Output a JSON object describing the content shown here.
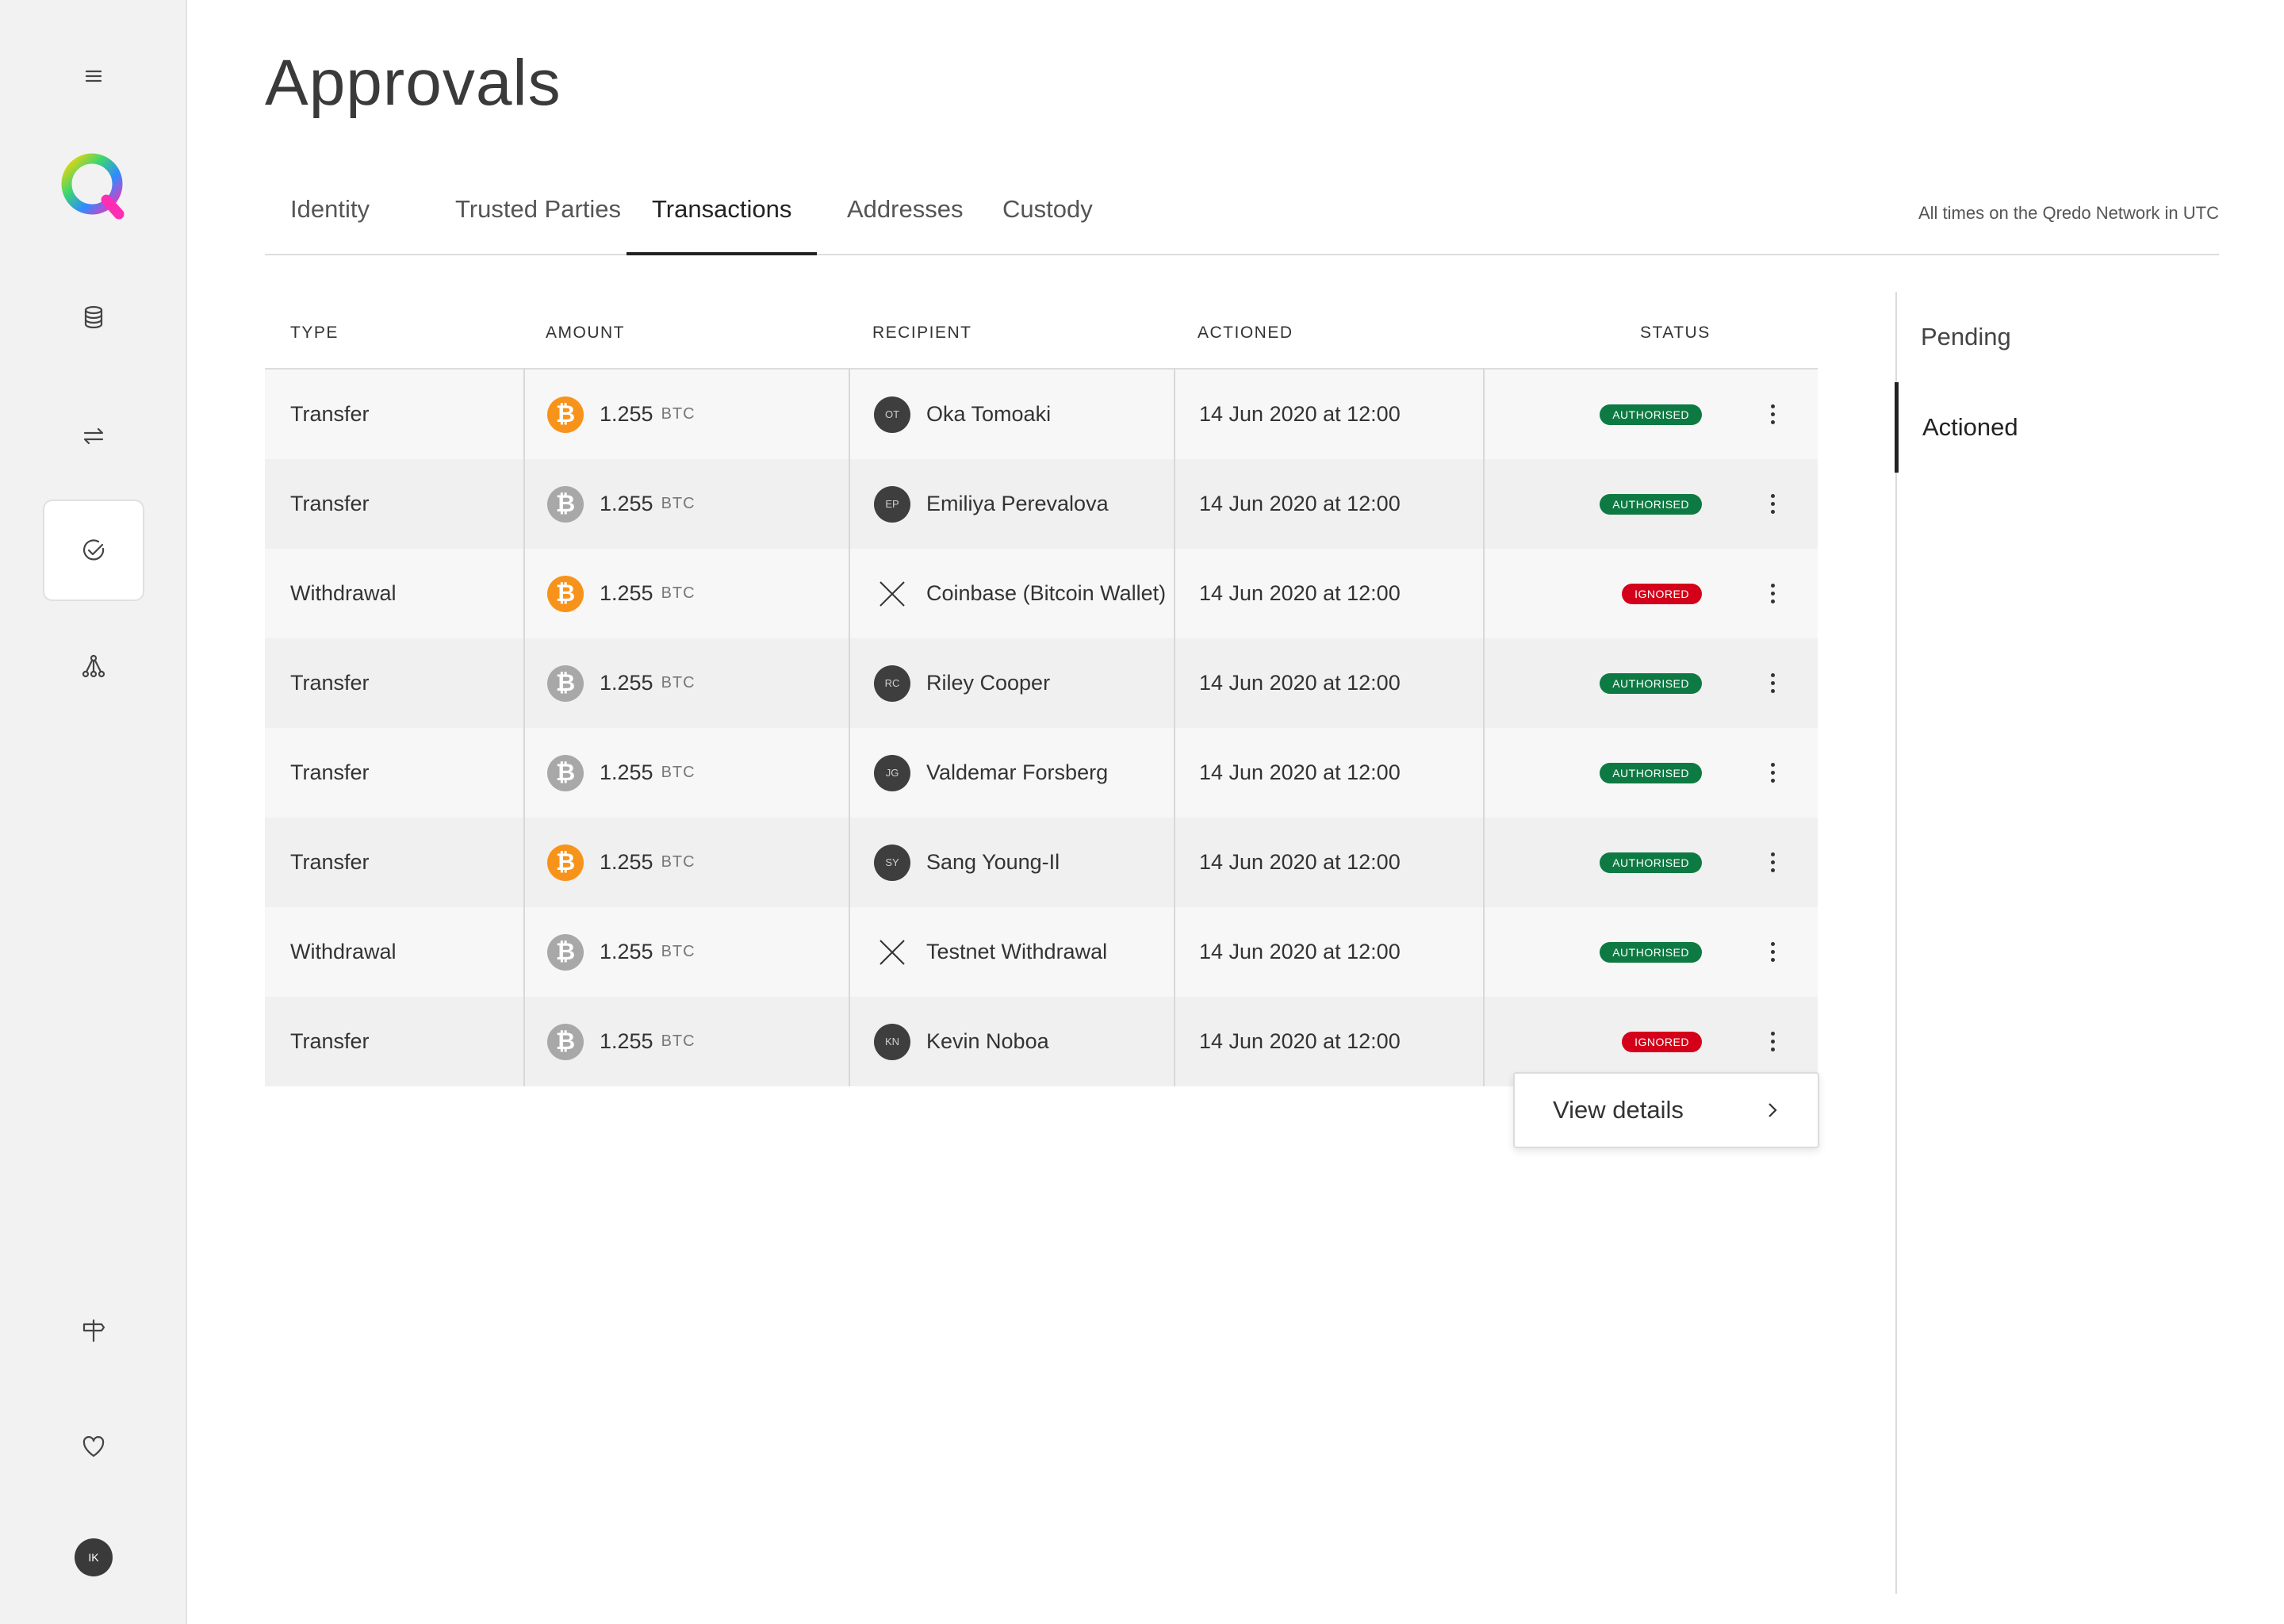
{
  "page": {
    "title": "Approvals",
    "timezone_note": "All times on the Qredo Network in UTC"
  },
  "sidebar": {
    "icons": [
      "menu-icon",
      "database-icon",
      "transfer-arrows-icon",
      "approvals-check-icon",
      "network-icon",
      "signpost-icon",
      "heart-icon"
    ],
    "active": "approvals-check-icon",
    "user_initials": "IK"
  },
  "tabs": [
    {
      "label": "Identity"
    },
    {
      "label": "Trusted Parties"
    },
    {
      "label": "Transactions",
      "active": true
    },
    {
      "label": "Addresses"
    },
    {
      "label": "Custody"
    }
  ],
  "table": {
    "headers": {
      "type": "TYPE",
      "amount": "AMOUNT",
      "recipient": "RECIPIENT",
      "actioned": "ACTIONED",
      "status": "STATUS"
    },
    "rows": [
      {
        "type": "Transfer",
        "coin": "orange",
        "amount": "1.255",
        "unit": "BTC",
        "recipient_kind": "avatar",
        "recipient_initials": "OT",
        "recipient": "Oka Tomoaki",
        "actioned": "14 Jun 2020 at 12:00",
        "status": "AUTHORISED",
        "status_color": "#0e7a43"
      },
      {
        "type": "Transfer",
        "coin": "grey",
        "amount": "1.255",
        "unit": "BTC",
        "recipient_kind": "avatar",
        "recipient_initials": "EP",
        "recipient": "Emiliya Perevalova",
        "actioned": "14 Jun 2020 at 12:00",
        "status": "AUTHORISED",
        "status_color": "#0e7a43"
      },
      {
        "type": "Withdrawal",
        "coin": "orange",
        "amount": "1.255",
        "unit": "BTC",
        "recipient_kind": "external",
        "recipient_initials": "",
        "recipient": "Coinbase (Bitcoin Wallet)",
        "actioned": "14 Jun 2020 at 12:00",
        "status": "IGNORED",
        "status_color": "#d4001a"
      },
      {
        "type": "Transfer",
        "coin": "grey",
        "amount": "1.255",
        "unit": "BTC",
        "recipient_kind": "avatar",
        "recipient_initials": "RC",
        "recipient": "Riley Cooper",
        "actioned": "14 Jun 2020 at 12:00",
        "status": "AUTHORISED",
        "status_color": "#0e7a43"
      },
      {
        "type": "Transfer",
        "coin": "grey",
        "amount": "1.255",
        "unit": "BTC",
        "recipient_kind": "avatar",
        "recipient_initials": "JG",
        "recipient": "Valdemar Forsberg",
        "actioned": "14 Jun 2020 at 12:00",
        "status": "AUTHORISED",
        "status_color": "#0e7a43"
      },
      {
        "type": "Transfer",
        "coin": "orange",
        "amount": "1.255",
        "unit": "BTC",
        "recipient_kind": "avatar",
        "recipient_initials": "SY",
        "recipient": "Sang Young-Il",
        "actioned": "14 Jun 2020 at 12:00",
        "status": "AUTHORISED",
        "status_color": "#0e7a43"
      },
      {
        "type": "Withdrawal",
        "coin": "grey",
        "amount": "1.255",
        "unit": "BTC",
        "recipient_kind": "external",
        "recipient_initials": "",
        "recipient": "Testnet Withdrawal",
        "actioned": "14 Jun 2020 at 12:00",
        "status": "AUTHORISED",
        "status_color": "#0e7a43"
      },
      {
        "type": "Transfer",
        "coin": "grey",
        "amount": "1.255",
        "unit": "BTC",
        "recipient_kind": "avatar",
        "recipient_initials": "KN",
        "recipient": "Kevin Noboa",
        "actioned": "14 Jun 2020 at 12:00",
        "status": "IGNORED",
        "status_color": "#d4001a"
      }
    ]
  },
  "row_menu": {
    "label": "View details"
  },
  "filters": [
    {
      "label": "Pending"
    },
    {
      "label": "Actioned",
      "active": true
    }
  ],
  "colors": {
    "btc_orange": "#f7931a",
    "btc_grey": "#a8a8a8",
    "authorised": "#0e7a43",
    "ignored": "#d4001a"
  }
}
